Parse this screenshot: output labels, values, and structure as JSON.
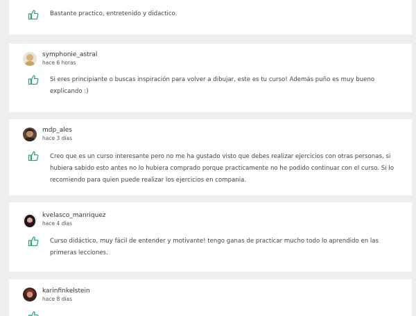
{
  "reviews": [
    {
      "username": "",
      "time": "",
      "text": "Bastante practico, entretenido y didactico."
    },
    {
      "username": "symphonie_astral",
      "time": "hace 6 horas",
      "text": "Si eres principiante o buscas inspiración para volver a dibujar, este es tu curso! Además puño es muy bueno explicando :)"
    },
    {
      "username": "mdp_ales",
      "time": "hace 3 días",
      "text": "Creo que es un curso interesante pero no me ha gustado visto que debes realizar ejercicios con otras personas, si hubiera sabido esto antes no lo hubiera comprado porque practicamente no he podido continuar con el curso. Si lo recomiendo para quien puede realizar los ejercicios en compania."
    },
    {
      "username": "kvelasco_manriquez",
      "time": "hace 4 días",
      "text": "Curso didáctico, muy fácil de entender y motivante! tengo ganas de practicar mucho todo lo aprendido en las primeras lecciones."
    },
    {
      "username": "karinfinkelstein",
      "time": "hace 8 días",
      "text": ""
    }
  ],
  "colors": {
    "like_icon": "#2ea37f",
    "background": "#eeeeee",
    "card": "#ffffff"
  },
  "icons": {
    "like": "thumbs-up-icon",
    "avatar": "avatar"
  }
}
